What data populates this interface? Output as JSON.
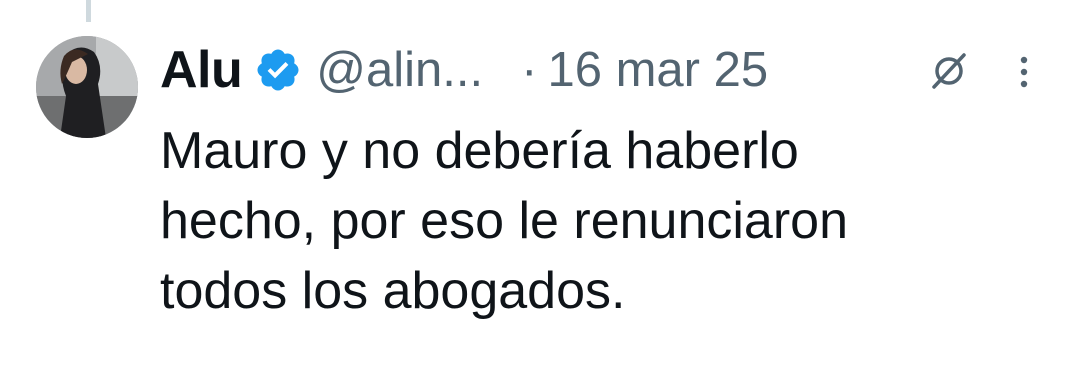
{
  "tweet": {
    "display_name": "Alu",
    "handle": "@alin...",
    "separator": "·",
    "timestamp": "16 mar 25",
    "verified": true,
    "text_lines": [
      "Mauro y no debería haberlo",
      "hecho, por eso le renunciaron",
      "todos los abogados."
    ]
  },
  "icons": {
    "verified": "verified-badge-icon",
    "grok": "grok-icon",
    "more": "more-options-icon"
  },
  "colors": {
    "text_primary": "#0f1419",
    "text_secondary": "#536471",
    "verified_blue": "#1d9bf0",
    "thread_line": "#cfd9de"
  }
}
